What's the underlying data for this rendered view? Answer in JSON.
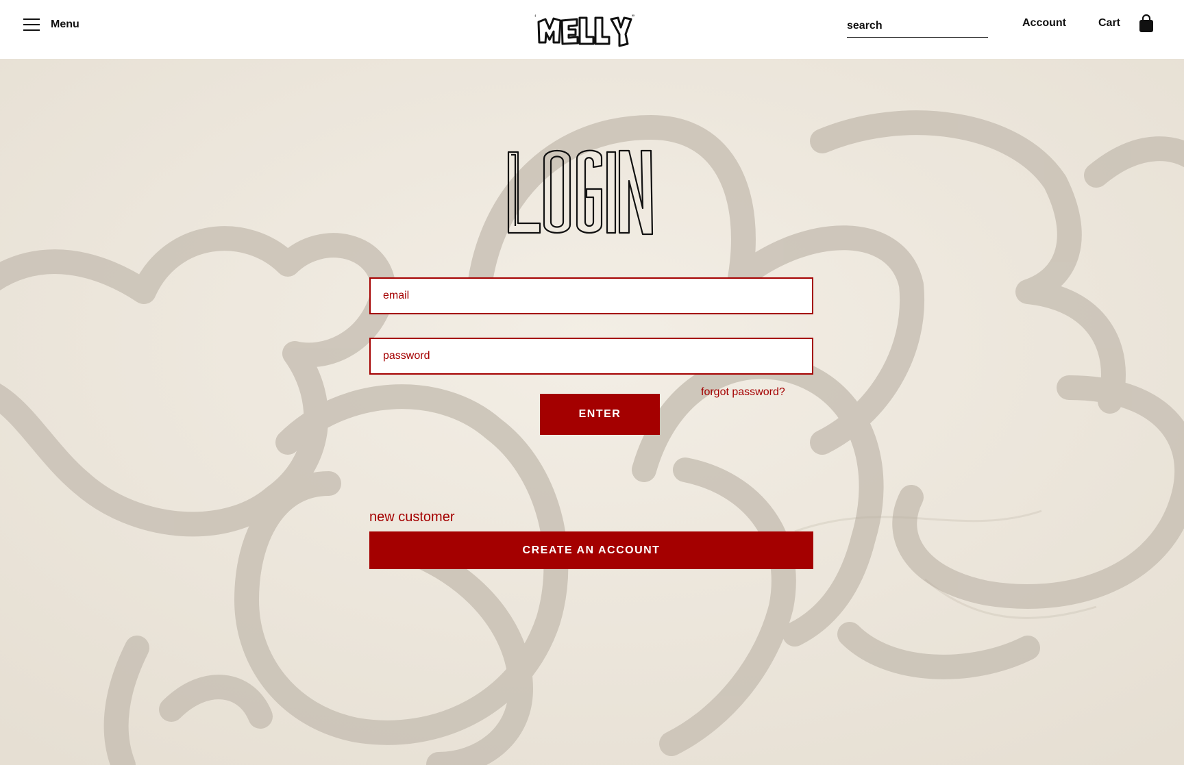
{
  "header": {
    "menu_label": "Menu",
    "logo_text": "MELLY",
    "search_placeholder": "search",
    "account_label": "Account",
    "cart_label": "Cart"
  },
  "login": {
    "title": "LOGIN",
    "email_placeholder": "email",
    "password_placeholder": "password",
    "forgot_label": "forgot password?",
    "enter_label": "ENTER",
    "new_customer_label": "new customer",
    "create_account_label": "CREATE AN ACCOUNT"
  },
  "colors": {
    "accent": "#a40000",
    "background": "#efe9df",
    "graffiti": "#cbc3b7"
  }
}
